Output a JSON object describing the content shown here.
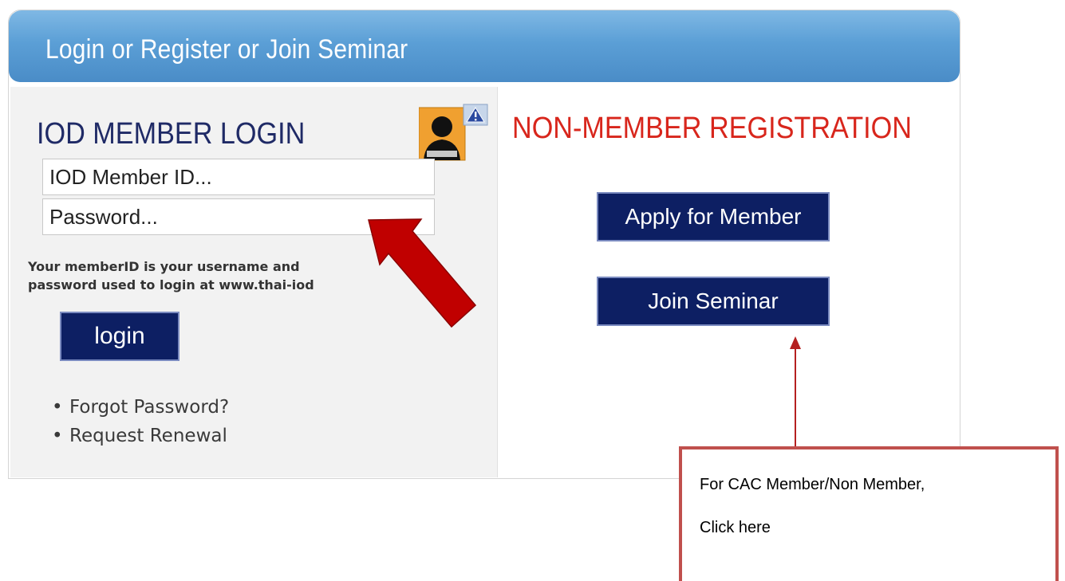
{
  "panel": {
    "title": "Login or Register or Join Seminar"
  },
  "login": {
    "heading": "IOD MEMBER LOGIN",
    "member_id_placeholder": "IOD Member ID...",
    "password_placeholder": "Password...",
    "info_line1": "Your memberID is your username a",
    "info_line1_tail": "nd",
    "info_line2": "password used to login at www.thai-io",
    "info_line2_tail": "d",
    "login_label": "login",
    "links": [
      {
        "label": "Forgot Password?"
      },
      {
        "label": "Request Renewal"
      }
    ]
  },
  "registration": {
    "heading": "NON-MEMBER REGISTRATION",
    "apply_label": "Apply for Member",
    "seminar_label": "Join Seminar"
  },
  "annotation": {
    "callout_line1": "For CAC Member/Non Member,",
    "callout_line2": "Click here"
  },
  "colors": {
    "header_blue": "#5b9fd6",
    "button_navy": "#0d1f63",
    "heading_navy": "#1f2a66",
    "heading_red": "#d8261c",
    "arrow_red": "#c00000",
    "callout_border": "#c0504d"
  },
  "icons": {
    "member_icon": "member-silhouette-icon",
    "warning_icon": "warning-triangle-icon",
    "bullet": "•"
  }
}
